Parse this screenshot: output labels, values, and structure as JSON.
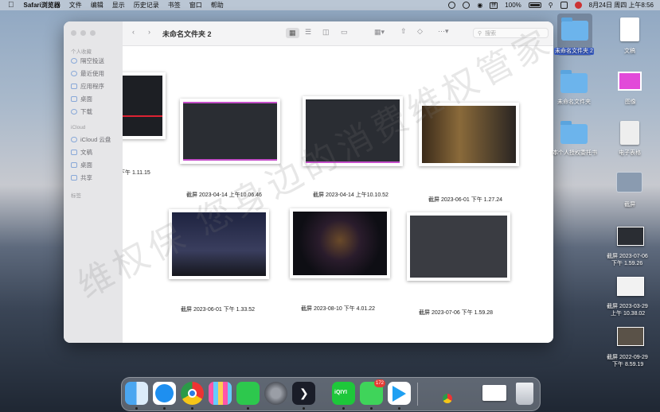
{
  "menubar": {
    "app_name": "Safari浏览器",
    "menus": [
      "文件",
      "编辑",
      "显示",
      "历史记录",
      "书签",
      "窗口",
      "帮助"
    ],
    "battery": "100%",
    "input_method": "拼",
    "datetime": "8月24日 周四 上午8:56"
  },
  "finder": {
    "title": "未命名文件夹 2",
    "search_placeholder": "搜索",
    "sidebar": {
      "favorites_header": "个人收藏",
      "favorites": [
        "隔空投送",
        "最近使用",
        "应用程序",
        "桌面",
        "下载"
      ],
      "icloud_header": "iCloud",
      "icloud": [
        "iCloud 云盘",
        "文稿",
        "桌面",
        "共享"
      ],
      "tags_header": "标签"
    },
    "files": [
      {
        "caption": "下午 1.11.15"
      },
      {
        "caption": "截屏 2023-04-14 上午10.06.46"
      },
      {
        "caption": "截屏 2023-04-14 上午10.10.52"
      },
      {
        "caption": "截屏 2023-06-01 下午 1.27.24"
      },
      {
        "caption": "截屏 2023-06-01 下午 1.33.52"
      },
      {
        "caption": "截屏 2023-08-10 下午 4.01.22"
      },
      {
        "caption": "截屏 2023-07-06 下午 1.59.28"
      }
    ]
  },
  "desktop": {
    "items": [
      {
        "label": "未命名文件夹 2",
        "kind": "folder"
      },
      {
        "label": "文稿",
        "kind": "doc"
      },
      {
        "label": "未命名文件夹",
        "kind": "folder"
      },
      {
        "label": "图像",
        "kind": "image"
      },
      {
        "label": "本个人授权委托书",
        "kind": "folder"
      },
      {
        "label": "电子表格",
        "kind": "sheet"
      },
      {
        "label": "截屏",
        "kind": "stack"
      },
      {
        "label": "截屏 2023-07-06",
        "sub": "下午 1.59.26",
        "kind": "shot"
      },
      {
        "label": "截屏 2023-03-29",
        "sub": "上午 10.38.02",
        "kind": "shot"
      },
      {
        "label": "截屏 2022-09-29",
        "sub": "下午 8.59.19",
        "kind": "shot"
      }
    ]
  },
  "dock": {
    "apps": [
      "finder-icon",
      "safari-icon",
      "chrome-icon",
      "launchpad-icon",
      "wechat-icon",
      "settings-icon",
      "prompt-icon",
      "iqiyi-icon",
      "messages-icon",
      "tencent-video-icon",
      "trash-icon"
    ],
    "iqiyi_label": "iQIYI",
    "messages_badge": "172"
  },
  "watermark": "维权保 您身边的消费维权管家"
}
